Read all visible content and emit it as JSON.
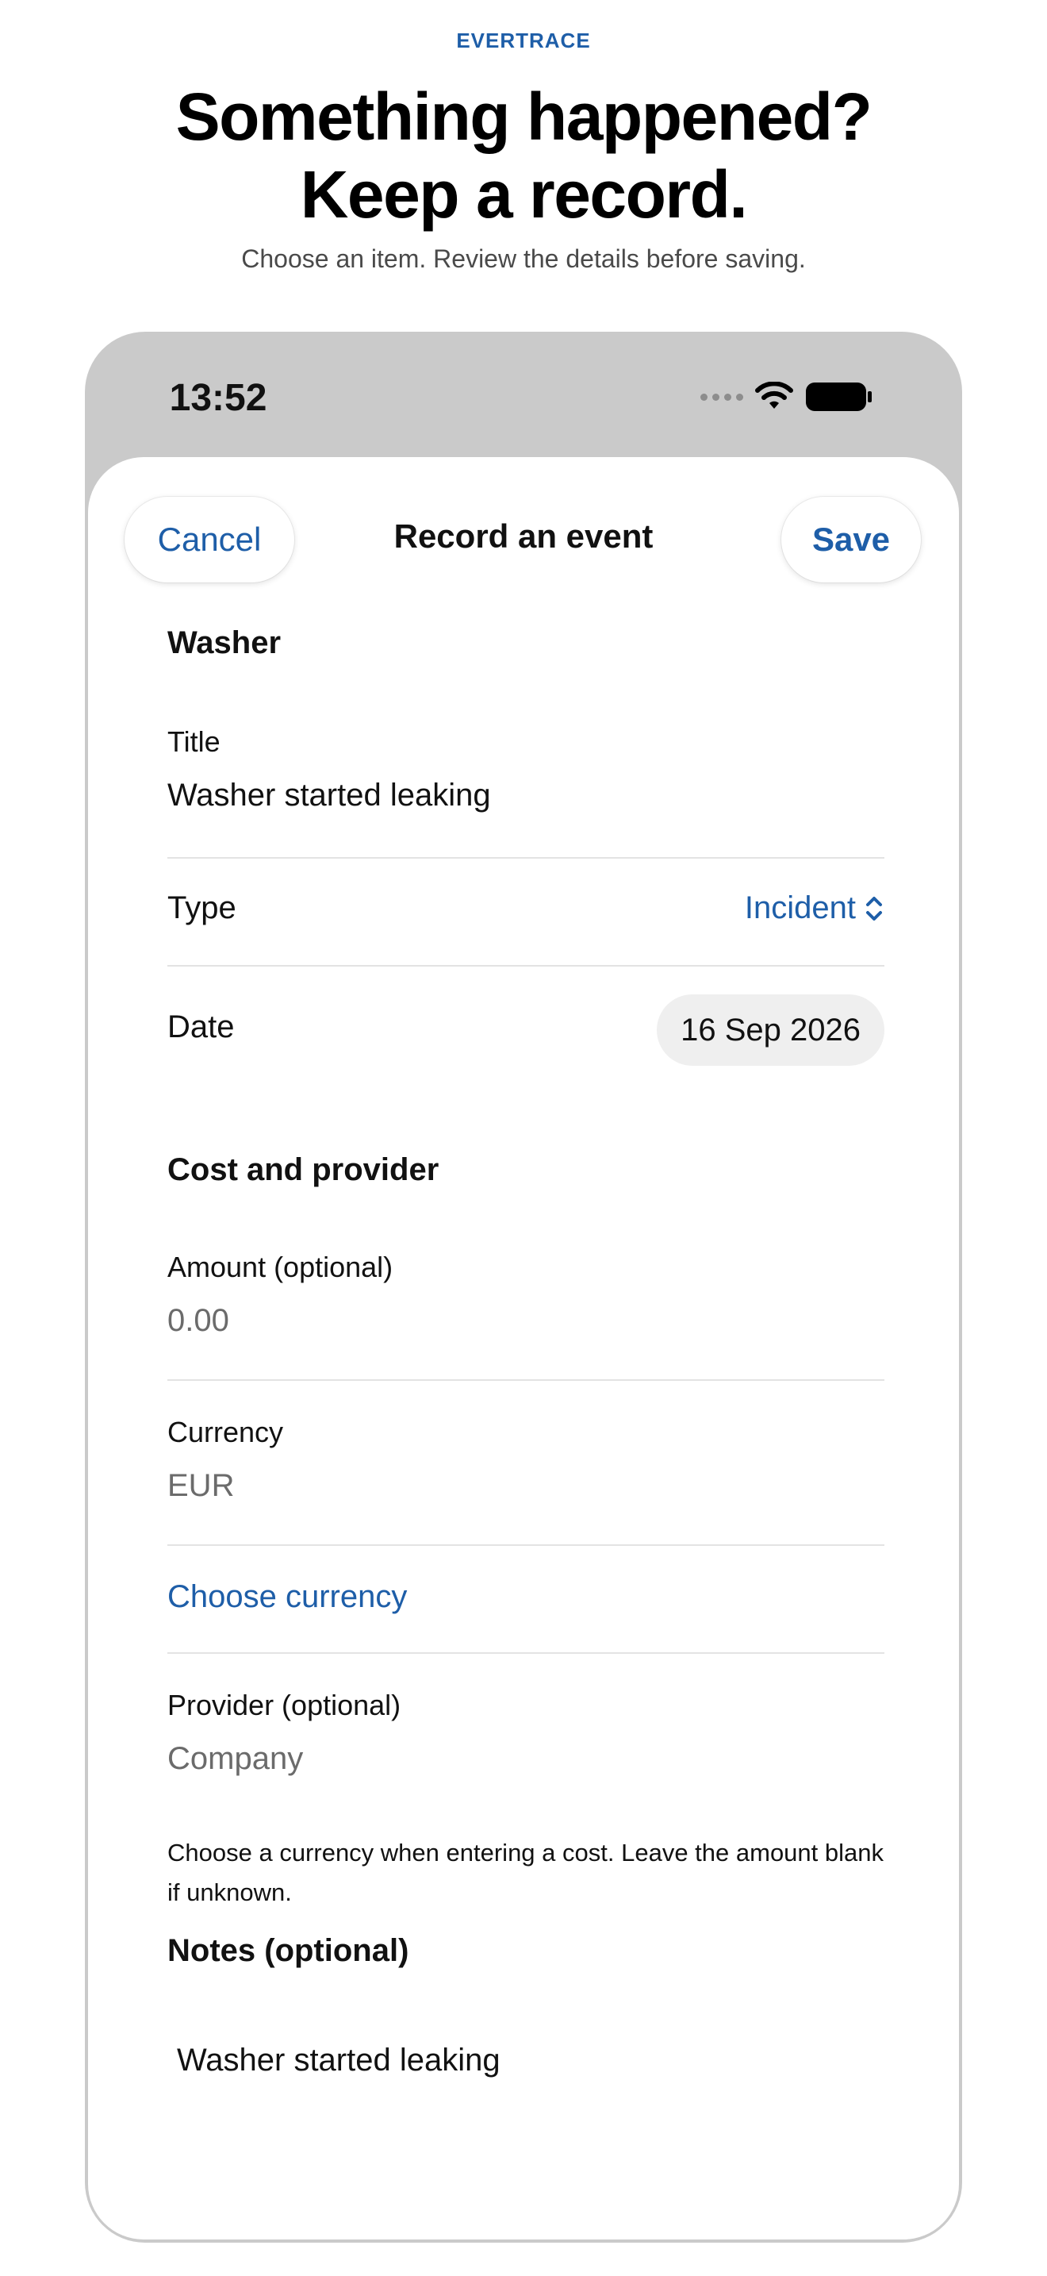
{
  "header": {
    "brand": "EVERTRACE",
    "headline_line1": "Something happened?",
    "headline_line2": "Keep a record.",
    "subline": "Choose an item. Review the details before saving."
  },
  "status_bar": {
    "time": "13:52",
    "icons": [
      "signal-dots-icon",
      "wifi-icon",
      "battery-icon"
    ]
  },
  "sheet": {
    "cancel_label": "Cancel",
    "title": "Record an event",
    "save_label": "Save"
  },
  "form": {
    "item_name": "Washer",
    "title_label": "Title",
    "title_value": "Washer started leaking",
    "type_label": "Type",
    "type_value": "Incident",
    "date_label": "Date",
    "date_value": "16 Sep 2026",
    "cost_section": "Cost and provider",
    "amount_label": "Amount (optional)",
    "amount_placeholder": "0.00",
    "currency_label": "Currency",
    "currency_value": "EUR",
    "choose_currency": "Choose currency",
    "provider_label": "Provider (optional)",
    "provider_placeholder": "Company",
    "cost_footnote": "Choose a currency when entering a cost. Leave the amount blank if unknown.",
    "notes_section": "Notes (optional)",
    "notes_value": "Washer started leaking"
  },
  "colors": {
    "accent": "#1e5ea8",
    "device_frame": "#cacaca",
    "chip_background": "#efefef"
  }
}
